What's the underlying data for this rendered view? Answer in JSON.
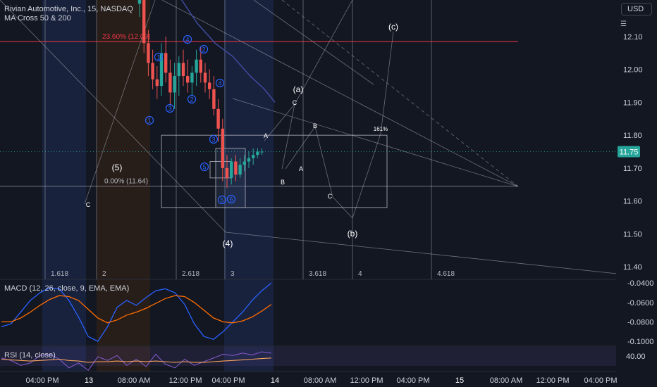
{
  "header": {
    "symbol_title": "Rivian Automotive, Inc., 15, NASDAQ",
    "indicator": "MA Cross 50 & 200",
    "currency_button": "USD"
  },
  "colors": {
    "background": "#131722",
    "up_candle": "#26a69a",
    "down_candle": "#ef5350",
    "ma_line": "#3f4a9e",
    "fib_line": "#f23645",
    "last_price_label": "#26a69a",
    "macd_line": "#2962ff",
    "signal_line": "#ff6d00",
    "rsi_line": "#7e57c2",
    "rsi_ma": "#f7a35c"
  },
  "chart_data": [
    {
      "type": "candlestick",
      "pane": "price",
      "ylim": [
        11.36,
        12.28
      ],
      "y_ticks": [
        "12.10",
        "12.00",
        "11.90",
        "11.80",
        "11.70",
        "11.60",
        "11.50",
        "11.40"
      ],
      "last_price": "11.75",
      "x_ticks": [
        "04:00 PM",
        "13",
        "08:00 AM",
        "12:00 PM",
        "04:00 PM",
        "14",
        "08:00 AM",
        "12:00 PM",
        "04:00 PM",
        "15",
        "08:00 AM",
        "12:00 PM",
        "04:00 PM"
      ],
      "fib_time_labels": [
        "1.618",
        "2",
        "2.618",
        "3",
        "3.618",
        "4",
        "4.618"
      ],
      "fib_level_labels": [
        {
          "label": "23.60% (12.09)",
          "price": 12.085
        },
        {
          "label": "0.00% (11.64)",
          "price": 11.645
        }
      ],
      "wave_labels": [
        "C",
        "(5)",
        "(4)",
        "(a)",
        "C",
        "A",
        "B",
        "A",
        "B",
        "C",
        "(b)",
        "(c)",
        "161%"
      ],
      "circled_labels": [
        "4",
        "2",
        "1",
        "2",
        "4",
        "3",
        "1",
        "3",
        "5",
        "5",
        "6"
      ],
      "candles": [
        {
          "o": 12.2,
          "h": 12.28,
          "l": 12.16,
          "c": 12.24
        },
        {
          "o": 12.24,
          "h": 12.28,
          "l": 12.05,
          "c": 12.08
        },
        {
          "o": 12.08,
          "h": 12.12,
          "l": 11.98,
          "c": 12.02
        },
        {
          "o": 12.02,
          "h": 12.06,
          "l": 11.94,
          "c": 11.97
        },
        {
          "o": 11.97,
          "h": 12.01,
          "l": 11.91,
          "c": 11.95
        },
        {
          "o": 11.95,
          "h": 12.08,
          "l": 11.92,
          "c": 12.05
        },
        {
          "o": 12.05,
          "h": 12.1,
          "l": 11.96,
          "c": 11.99
        },
        {
          "o": 11.99,
          "h": 12.03,
          "l": 11.89,
          "c": 11.93
        },
        {
          "o": 11.93,
          "h": 12.02,
          "l": 11.88,
          "c": 11.98
        },
        {
          "o": 11.98,
          "h": 12.04,
          "l": 11.92,
          "c": 12.02
        },
        {
          "o": 12.02,
          "h": 12.06,
          "l": 11.95,
          "c": 11.98
        },
        {
          "o": 11.98,
          "h": 12.03,
          "l": 11.93,
          "c": 11.96
        },
        {
          "o": 11.96,
          "h": 12.01,
          "l": 11.92,
          "c": 11.99
        },
        {
          "o": 11.99,
          "h": 12.06,
          "l": 11.95,
          "c": 12.03
        },
        {
          "o": 12.03,
          "h": 12.07,
          "l": 11.96,
          "c": 11.99
        },
        {
          "o": 11.99,
          "h": 12.02,
          "l": 11.93,
          "c": 11.96
        },
        {
          "o": 11.96,
          "h": 12.0,
          "l": 11.91,
          "c": 11.94
        },
        {
          "o": 11.94,
          "h": 11.98,
          "l": 11.86,
          "c": 11.88
        },
        {
          "o": 11.88,
          "h": 11.91,
          "l": 11.78,
          "c": 11.82
        },
        {
          "o": 11.82,
          "h": 11.85,
          "l": 11.66,
          "c": 11.7
        },
        {
          "o": 11.7,
          "h": 11.74,
          "l": 11.64,
          "c": 11.67
        },
        {
          "o": 11.67,
          "h": 11.73,
          "l": 11.65,
          "c": 11.72
        },
        {
          "o": 11.72,
          "h": 11.74,
          "l": 11.66,
          "c": 11.68
        },
        {
          "o": 11.68,
          "h": 11.73,
          "l": 11.67,
          "c": 11.71
        },
        {
          "o": 11.71,
          "h": 11.74,
          "l": 11.69,
          "c": 11.72
        },
        {
          "o": 11.72,
          "h": 11.75,
          "l": 11.7,
          "c": 11.73
        },
        {
          "o": 11.73,
          "h": 11.76,
          "l": 11.71,
          "c": 11.74
        },
        {
          "o": 11.74,
          "h": 11.76,
          "l": 11.73,
          "c": 11.75
        },
        {
          "o": 11.75,
          "h": 11.76,
          "l": 11.74,
          "c": 11.75
        }
      ],
      "ma_line": [
        12.3,
        12.22,
        12.14,
        12.08,
        12.04,
        11.98,
        11.94,
        11.9
      ]
    },
    {
      "type": "line",
      "pane": "macd",
      "title": "MACD (12, 26, close, 9, EMA, EMA)",
      "ylim": [
        -0.105,
        -0.037
      ],
      "y_ticks": [
        "-0.0400",
        "-0.0600",
        "-0.0800",
        "-0.1000"
      ],
      "series": [
        {
          "values": [
            -0.085,
            -0.082,
            -0.07,
            -0.058,
            -0.05,
            -0.045,
            -0.046,
            -0.058,
            -0.075,
            -0.095,
            -0.1,
            -0.085,
            -0.065,
            -0.058,
            -0.063,
            -0.055,
            -0.048,
            -0.046,
            -0.05,
            -0.062,
            -0.082,
            -0.095,
            -0.098,
            -0.09,
            -0.08,
            -0.07,
            -0.058,
            -0.048,
            -0.04
          ]
        },
        {
          "values": [
            -0.08,
            -0.08,
            -0.076,
            -0.07,
            -0.063,
            -0.057,
            -0.053,
            -0.054,
            -0.058,
            -0.067,
            -0.076,
            -0.081,
            -0.078,
            -0.073,
            -0.07,
            -0.066,
            -0.061,
            -0.056,
            -0.053,
            -0.054,
            -0.06,
            -0.068,
            -0.076,
            -0.08,
            -0.081,
            -0.079,
            -0.075,
            -0.069,
            -0.062
          ]
        }
      ]
    },
    {
      "type": "line",
      "pane": "rsi",
      "title": "RSI (14, close)",
      "y_ticks": [
        "40.00"
      ],
      "series": [
        {
          "values": [
            42,
            38,
            30,
            34,
            46,
            48,
            40,
            26,
            34,
            22,
            44,
            38,
            46,
            30,
            40,
            28,
            48,
            32,
            26,
            40,
            30,
            36,
            42,
            48,
            46,
            50,
            47,
            52,
            50
          ]
        },
        {
          "values": [
            40,
            39,
            38,
            37,
            38,
            39,
            40,
            38,
            37,
            35,
            36,
            36,
            37,
            36,
            37,
            36,
            37,
            36,
            35,
            36,
            35,
            35,
            36,
            37,
            38,
            39,
            40,
            41,
            42
          ]
        }
      ]
    }
  ]
}
